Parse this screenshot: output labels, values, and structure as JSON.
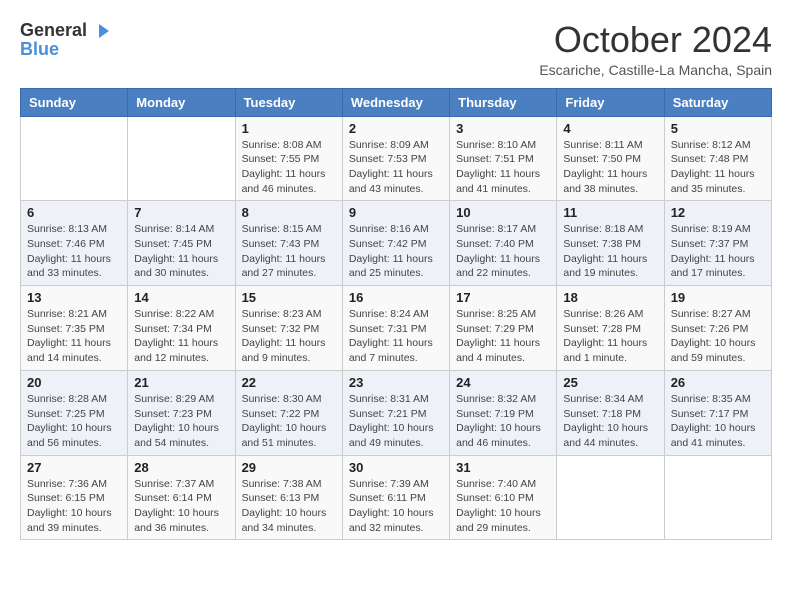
{
  "logo": {
    "line1": "General",
    "line2": "Blue"
  },
  "title": "October 2024",
  "subtitle": "Escariche, Castille-La Mancha, Spain",
  "days_of_week": [
    "Sunday",
    "Monday",
    "Tuesday",
    "Wednesday",
    "Thursday",
    "Friday",
    "Saturday"
  ],
  "weeks": [
    [
      {
        "day": "",
        "info": ""
      },
      {
        "day": "",
        "info": ""
      },
      {
        "day": "1",
        "info": "Sunrise: 8:08 AM\nSunset: 7:55 PM\nDaylight: 11 hours and 46 minutes."
      },
      {
        "day": "2",
        "info": "Sunrise: 8:09 AM\nSunset: 7:53 PM\nDaylight: 11 hours and 43 minutes."
      },
      {
        "day": "3",
        "info": "Sunrise: 8:10 AM\nSunset: 7:51 PM\nDaylight: 11 hours and 41 minutes."
      },
      {
        "day": "4",
        "info": "Sunrise: 8:11 AM\nSunset: 7:50 PM\nDaylight: 11 hours and 38 minutes."
      },
      {
        "day": "5",
        "info": "Sunrise: 8:12 AM\nSunset: 7:48 PM\nDaylight: 11 hours and 35 minutes."
      }
    ],
    [
      {
        "day": "6",
        "info": "Sunrise: 8:13 AM\nSunset: 7:46 PM\nDaylight: 11 hours and 33 minutes."
      },
      {
        "day": "7",
        "info": "Sunrise: 8:14 AM\nSunset: 7:45 PM\nDaylight: 11 hours and 30 minutes."
      },
      {
        "day": "8",
        "info": "Sunrise: 8:15 AM\nSunset: 7:43 PM\nDaylight: 11 hours and 27 minutes."
      },
      {
        "day": "9",
        "info": "Sunrise: 8:16 AM\nSunset: 7:42 PM\nDaylight: 11 hours and 25 minutes."
      },
      {
        "day": "10",
        "info": "Sunrise: 8:17 AM\nSunset: 7:40 PM\nDaylight: 11 hours and 22 minutes."
      },
      {
        "day": "11",
        "info": "Sunrise: 8:18 AM\nSunset: 7:38 PM\nDaylight: 11 hours and 19 minutes."
      },
      {
        "day": "12",
        "info": "Sunrise: 8:19 AM\nSunset: 7:37 PM\nDaylight: 11 hours and 17 minutes."
      }
    ],
    [
      {
        "day": "13",
        "info": "Sunrise: 8:21 AM\nSunset: 7:35 PM\nDaylight: 11 hours and 14 minutes."
      },
      {
        "day": "14",
        "info": "Sunrise: 8:22 AM\nSunset: 7:34 PM\nDaylight: 11 hours and 12 minutes."
      },
      {
        "day": "15",
        "info": "Sunrise: 8:23 AM\nSunset: 7:32 PM\nDaylight: 11 hours and 9 minutes."
      },
      {
        "day": "16",
        "info": "Sunrise: 8:24 AM\nSunset: 7:31 PM\nDaylight: 11 hours and 7 minutes."
      },
      {
        "day": "17",
        "info": "Sunrise: 8:25 AM\nSunset: 7:29 PM\nDaylight: 11 hours and 4 minutes."
      },
      {
        "day": "18",
        "info": "Sunrise: 8:26 AM\nSunset: 7:28 PM\nDaylight: 11 hours and 1 minute."
      },
      {
        "day": "19",
        "info": "Sunrise: 8:27 AM\nSunset: 7:26 PM\nDaylight: 10 hours and 59 minutes."
      }
    ],
    [
      {
        "day": "20",
        "info": "Sunrise: 8:28 AM\nSunset: 7:25 PM\nDaylight: 10 hours and 56 minutes."
      },
      {
        "day": "21",
        "info": "Sunrise: 8:29 AM\nSunset: 7:23 PM\nDaylight: 10 hours and 54 minutes."
      },
      {
        "day": "22",
        "info": "Sunrise: 8:30 AM\nSunset: 7:22 PM\nDaylight: 10 hours and 51 minutes."
      },
      {
        "day": "23",
        "info": "Sunrise: 8:31 AM\nSunset: 7:21 PM\nDaylight: 10 hours and 49 minutes."
      },
      {
        "day": "24",
        "info": "Sunrise: 8:32 AM\nSunset: 7:19 PM\nDaylight: 10 hours and 46 minutes."
      },
      {
        "day": "25",
        "info": "Sunrise: 8:34 AM\nSunset: 7:18 PM\nDaylight: 10 hours and 44 minutes."
      },
      {
        "day": "26",
        "info": "Sunrise: 8:35 AM\nSunset: 7:17 PM\nDaylight: 10 hours and 41 minutes."
      }
    ],
    [
      {
        "day": "27",
        "info": "Sunrise: 7:36 AM\nSunset: 6:15 PM\nDaylight: 10 hours and 39 minutes."
      },
      {
        "day": "28",
        "info": "Sunrise: 7:37 AM\nSunset: 6:14 PM\nDaylight: 10 hours and 36 minutes."
      },
      {
        "day": "29",
        "info": "Sunrise: 7:38 AM\nSunset: 6:13 PM\nDaylight: 10 hours and 34 minutes."
      },
      {
        "day": "30",
        "info": "Sunrise: 7:39 AM\nSunset: 6:11 PM\nDaylight: 10 hours and 32 minutes."
      },
      {
        "day": "31",
        "info": "Sunrise: 7:40 AM\nSunset: 6:10 PM\nDaylight: 10 hours and 29 minutes."
      },
      {
        "day": "",
        "info": ""
      },
      {
        "day": "",
        "info": ""
      }
    ]
  ]
}
